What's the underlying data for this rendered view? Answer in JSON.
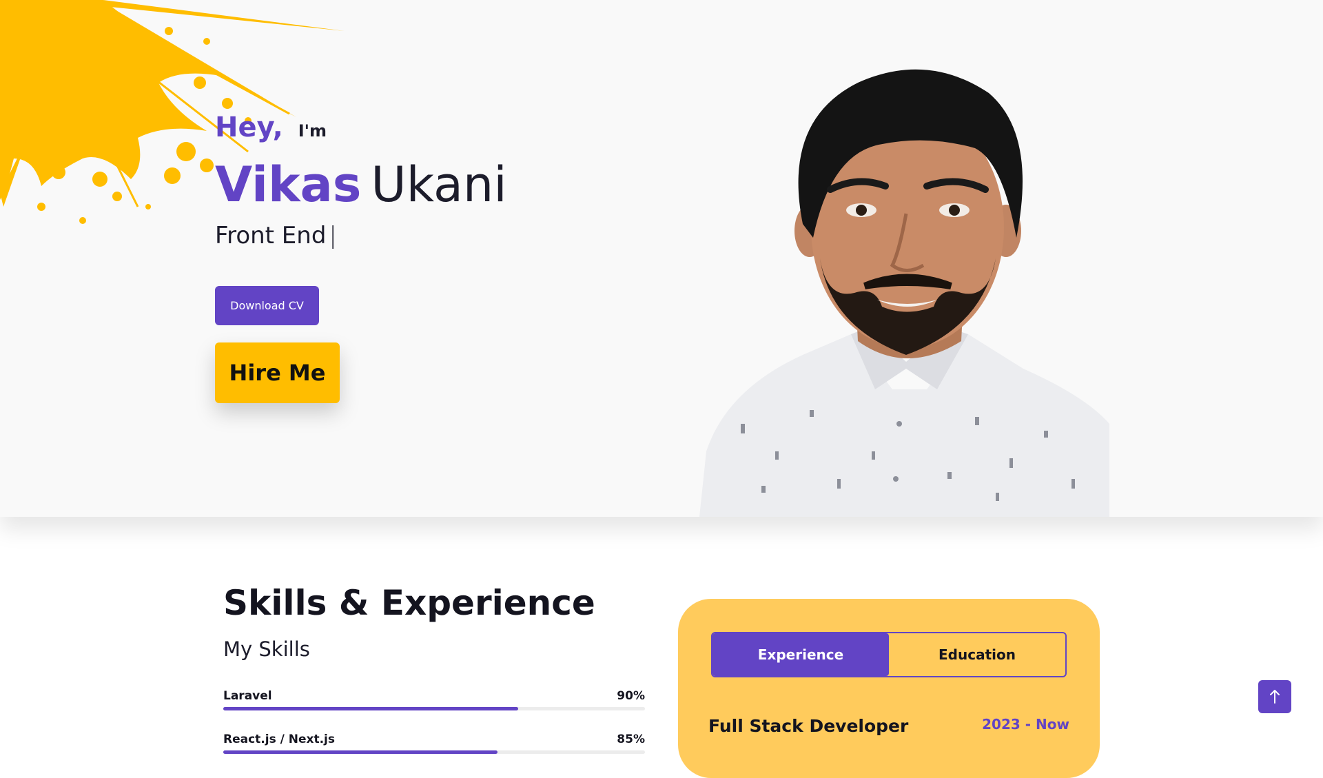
{
  "hero": {
    "greeting": "Hey,",
    "intro": "I'm",
    "first_name": "Vikas",
    "last_name": "Ukani",
    "role": "Front End",
    "caret": "|",
    "download_cv_label": "Download CV",
    "hire_me_label": "Hire Me"
  },
  "skills": {
    "title": "Skills & Experience",
    "subtitle": "My Skills",
    "items": [
      {
        "name": "Laravel",
        "percent_label": "90%",
        "value": 0.7
      },
      {
        "name": "React.js / Next.js",
        "percent_label": "85%",
        "value": 0.65
      }
    ]
  },
  "card": {
    "tabs": [
      {
        "label": "Experience",
        "active": true
      },
      {
        "label": "Education",
        "active": false
      }
    ],
    "job_title": "Full Stack Developer",
    "job_date": "2023 - Now"
  },
  "icons": {
    "scroll_top": "arrow-up-icon"
  },
  "colors": {
    "accent": "#6244c5",
    "highlight": "#ffbd00",
    "card_bg": "#ffcb5c"
  }
}
